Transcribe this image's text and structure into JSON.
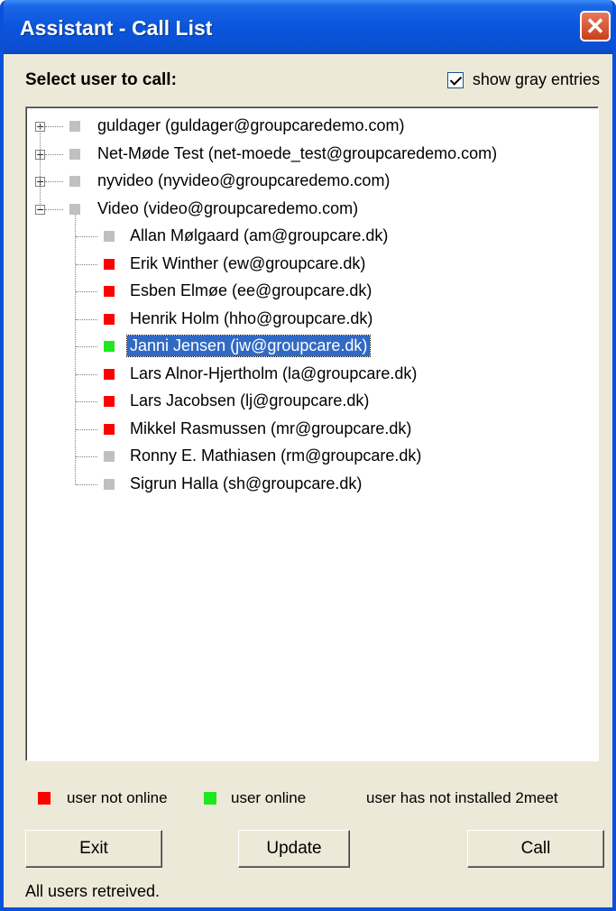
{
  "window": {
    "title": "Assistant - Call List",
    "close_label": "✕"
  },
  "header": {
    "select_label": "Select user to call:",
    "show_gray_label": "show gray entries",
    "show_gray_checked": true
  },
  "tree": {
    "groups": [
      {
        "label": "guldager (guldager@groupcaredemo.com)",
        "expanded": false,
        "status": "gray",
        "expander": "+"
      },
      {
        "label": "Net-Møde Test (net-moede_test@groupcaredemo.com)",
        "expanded": false,
        "status": "gray",
        "expander": "+"
      },
      {
        "label": "nyvideo (nyvideo@groupcaredemo.com)",
        "expanded": false,
        "status": "gray",
        "expander": "+"
      },
      {
        "label": "Video (video@groupcaredemo.com)",
        "expanded": true,
        "status": "gray",
        "expander": "−"
      }
    ],
    "users": [
      {
        "label": "Allan Mølgaard (am@groupcare.dk)",
        "status": "gray"
      },
      {
        "label": "Erik Winther (ew@groupcare.dk)",
        "status": "red"
      },
      {
        "label": "Esben Elmøe (ee@groupcare.dk)",
        "status": "red"
      },
      {
        "label": "Henrik Holm (hho@groupcare.dk)",
        "status": "red"
      },
      {
        "label": "Janni Jensen (jw@groupcare.dk)",
        "status": "green",
        "selected": true
      },
      {
        "label": "Lars Alnor-Hjertholm (la@groupcare.dk)",
        "status": "red"
      },
      {
        "label": "Lars Jacobsen (lj@groupcare.dk)",
        "status": "red"
      },
      {
        "label": "Mikkel Rasmussen (mr@groupcare.dk)",
        "status": "red"
      },
      {
        "label": "Ronny E. Mathiasen (rm@groupcare.dk)",
        "status": "gray"
      },
      {
        "label": "Sigrun Halla (sh@groupcare.dk)",
        "status": "gray"
      }
    ]
  },
  "legend": {
    "not_online": "user not online",
    "online": "user online",
    "not_installed": "user has not installed 2meet"
  },
  "buttons": {
    "exit": "Exit",
    "update": "Update",
    "call": "Call"
  },
  "status_text": "All users retreived.",
  "colors": {
    "red": "#ff0000",
    "green": "#1fe81f",
    "gray": "#c0c0c0",
    "titlebar": "#0a55dc",
    "selection": "#316ac5"
  }
}
